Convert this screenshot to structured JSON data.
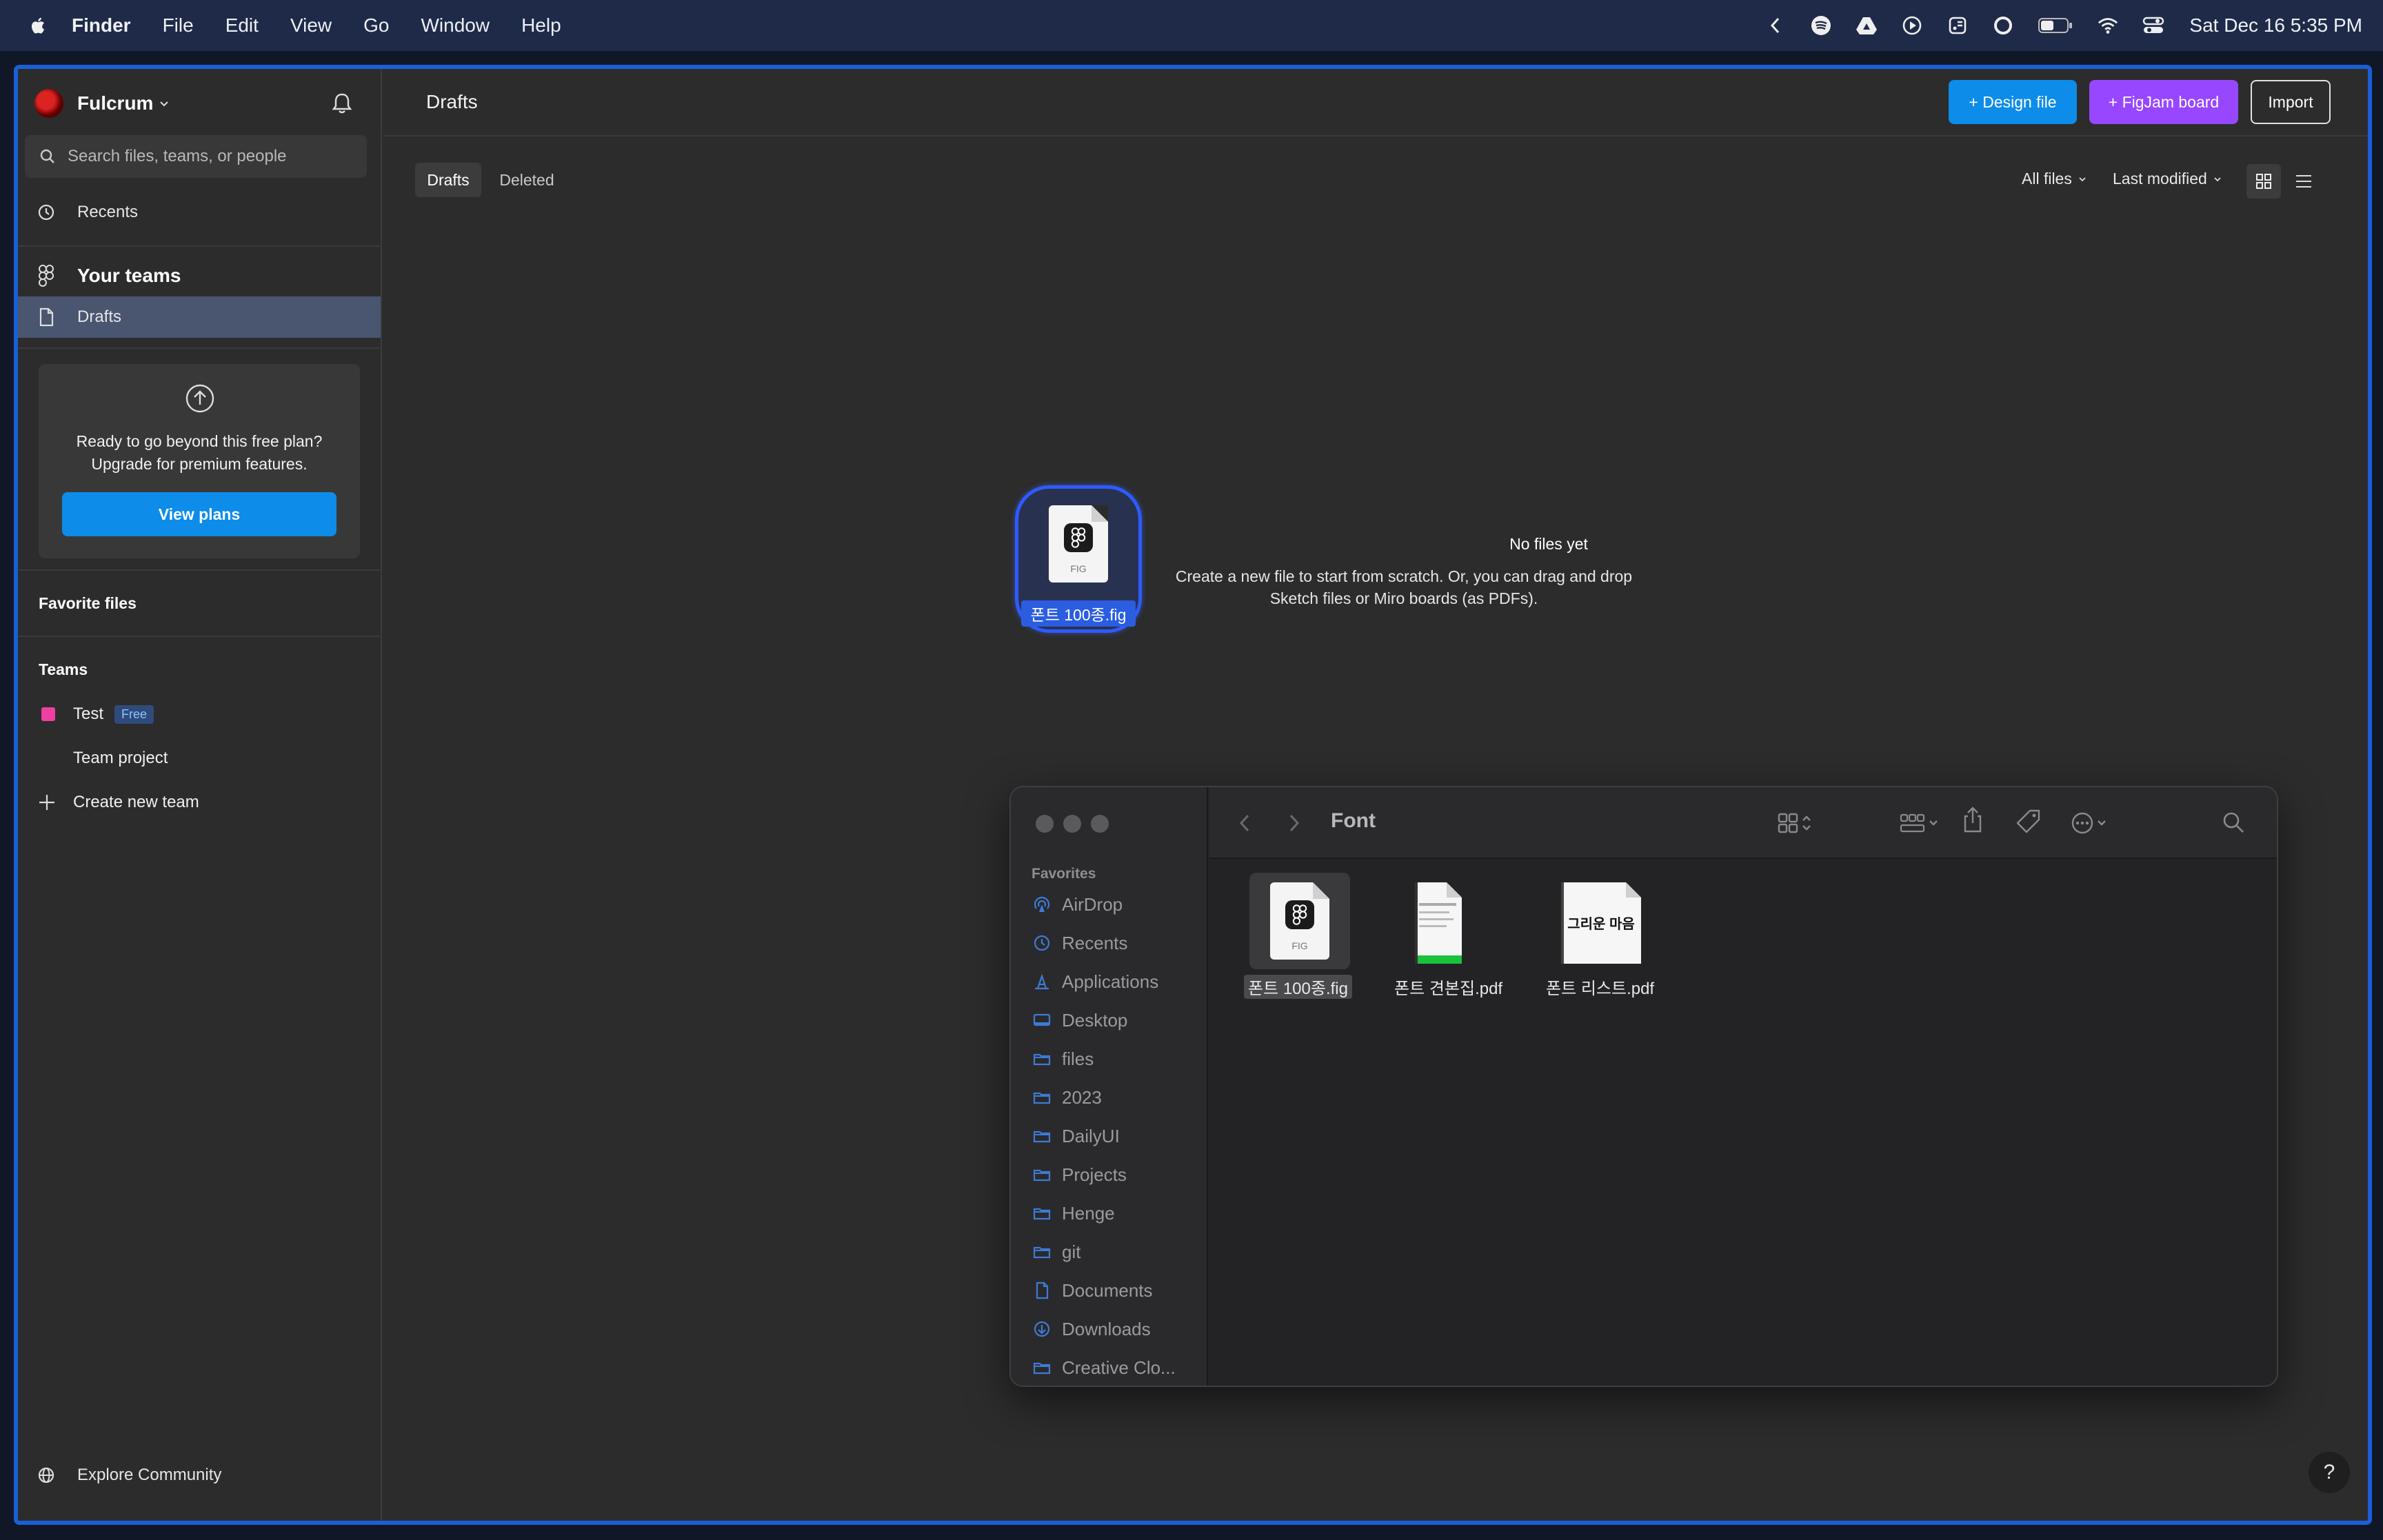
{
  "menubar": {
    "app": "Finder",
    "items": [
      "File",
      "Edit",
      "View",
      "Go",
      "Window",
      "Help"
    ],
    "clock": "Sat Dec 16  5:35 PM"
  },
  "sidebar": {
    "team_name": "Fulcrum",
    "search_placeholder": "Search files, teams, or people",
    "recents": "Recents",
    "your_teams": "Your teams",
    "drafts": "Drafts",
    "upgrade_line1": "Ready to go beyond this free plan?",
    "upgrade_line2": "Upgrade for premium features.",
    "view_plans": "View plans",
    "favorite_files": "Favorite files",
    "teams_heading": "Teams",
    "team_test": "Test",
    "team_badge": "Free",
    "team_project": "Team project",
    "create_team": "Create new team",
    "explore": "Explore Community"
  },
  "main": {
    "title": "Drafts",
    "design_file": "+ Design file",
    "figjam_board": "+ FigJam board",
    "import": "Import",
    "tab_drafts": "Drafts",
    "tab_deleted": "Deleted",
    "filter_all": "All files",
    "filter_sort": "Last modified",
    "empty_title": "No files yet",
    "empty_line1": "Create a new file to start from scratch. Or, you can drag and drop",
    "empty_line2": "Sketch files or Miro boards (as PDFs).",
    "drag_label": "폰트 100종.fig",
    "drag_ext": "FIG",
    "help": "?"
  },
  "finder": {
    "title": "Font",
    "favorites_heading": "Favorites",
    "sidebar_items": [
      {
        "label": "AirDrop",
        "icon": "airdrop-icon"
      },
      {
        "label": "Recents",
        "icon": "clock-icon"
      },
      {
        "label": "Applications",
        "icon": "applications-icon"
      },
      {
        "label": "Desktop",
        "icon": "desktop-icon"
      },
      {
        "label": "files",
        "icon": "folder-icon"
      },
      {
        "label": "2023",
        "icon": "folder-icon"
      },
      {
        "label": "DailyUI",
        "icon": "folder-icon"
      },
      {
        "label": "Projects",
        "icon": "folder-icon"
      },
      {
        "label": "Henge",
        "icon": "folder-icon"
      },
      {
        "label": "git",
        "icon": "folder-icon"
      },
      {
        "label": "Documents",
        "icon": "document-icon"
      },
      {
        "label": "Downloads",
        "icon": "download-icon"
      },
      {
        "label": "Creative Clo...",
        "icon": "folder-icon"
      }
    ],
    "files": [
      {
        "name": "폰트 100종.fig",
        "ext": "FIG"
      },
      {
        "name": "폰트 견본집.pdf"
      },
      {
        "name": "폰트 리스트.pdf",
        "thumb_text": "그리운 마음"
      }
    ]
  },
  "colors": {
    "accent_blue": "#0d8ce9",
    "figjam_purple": "#9747ff",
    "team_pink": "#ee3fa3"
  }
}
